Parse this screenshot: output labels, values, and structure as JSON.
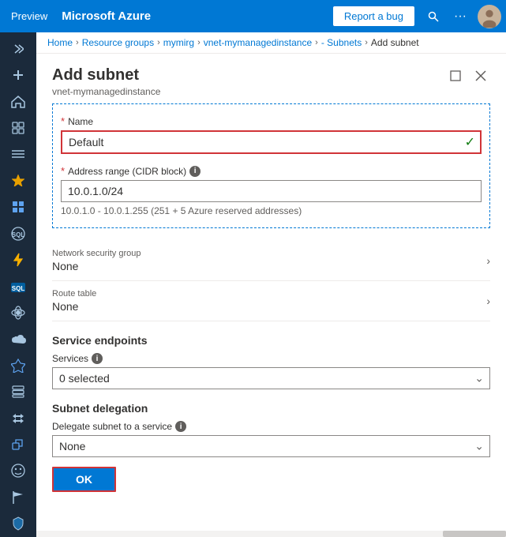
{
  "topnav": {
    "preview_label": "Preview",
    "title": "Microsoft Azure",
    "report_bug_label": "Report a bug",
    "search_icon": "🔍",
    "more_icon": "···"
  },
  "breadcrumb": {
    "items": [
      {
        "label": "Home",
        "current": false
      },
      {
        "label": "Resource groups",
        "current": false
      },
      {
        "label": "mymirg",
        "current": false
      },
      {
        "label": "vnet-mymanagedinstance",
        "current": false
      },
      {
        "label": "- Subnets",
        "current": false
      },
      {
        "label": "Add subnet",
        "current": true
      }
    ]
  },
  "panel": {
    "title": "Add subnet",
    "subtitle": "vnet-mymanagedinstance"
  },
  "form": {
    "name_label": "Name",
    "name_required": "*",
    "name_value": "Default",
    "address_range_label": "Address range (CIDR block)",
    "address_range_required": "*",
    "address_range_value": "10.0.1.0/24",
    "address_hint": "10.0.1.0 - 10.0.1.255 (251 + 5 Azure reserved addresses)",
    "nsg_label": "Network security group",
    "nsg_value": "None",
    "route_table_label": "Route table",
    "route_table_value": "None",
    "service_endpoints_heading": "Service endpoints",
    "services_label": "Services",
    "services_value": "0 selected",
    "subnet_delegation_heading": "Subnet delegation",
    "delegate_label": "Delegate subnet to a service",
    "delegate_value": "None",
    "ok_label": "OK"
  },
  "sidebar": {
    "items": [
      {
        "icon": "❯",
        "name": "collapse"
      },
      {
        "icon": "+",
        "name": "create"
      },
      {
        "icon": "⌂",
        "name": "home"
      },
      {
        "icon": "▣",
        "name": "dashboard"
      },
      {
        "icon": "☰",
        "name": "all-services"
      },
      {
        "icon": "★",
        "name": "favorites"
      },
      {
        "icon": "⊞",
        "name": "grid"
      },
      {
        "icon": "◈",
        "name": "sql"
      },
      {
        "icon": "⚡",
        "name": "lightning"
      },
      {
        "icon": "S",
        "name": "sql2"
      },
      {
        "icon": "◎",
        "name": "orbit"
      },
      {
        "icon": "☁",
        "name": "cloud"
      },
      {
        "icon": "✦",
        "name": "partner"
      },
      {
        "icon": "▤",
        "name": "storage"
      },
      {
        "icon": "↔",
        "name": "arrows"
      },
      {
        "icon": "◇",
        "name": "diamond"
      },
      {
        "icon": "☺",
        "name": "face"
      },
      {
        "icon": "⚑",
        "name": "flag"
      },
      {
        "icon": "🛡",
        "name": "shield"
      }
    ]
  }
}
